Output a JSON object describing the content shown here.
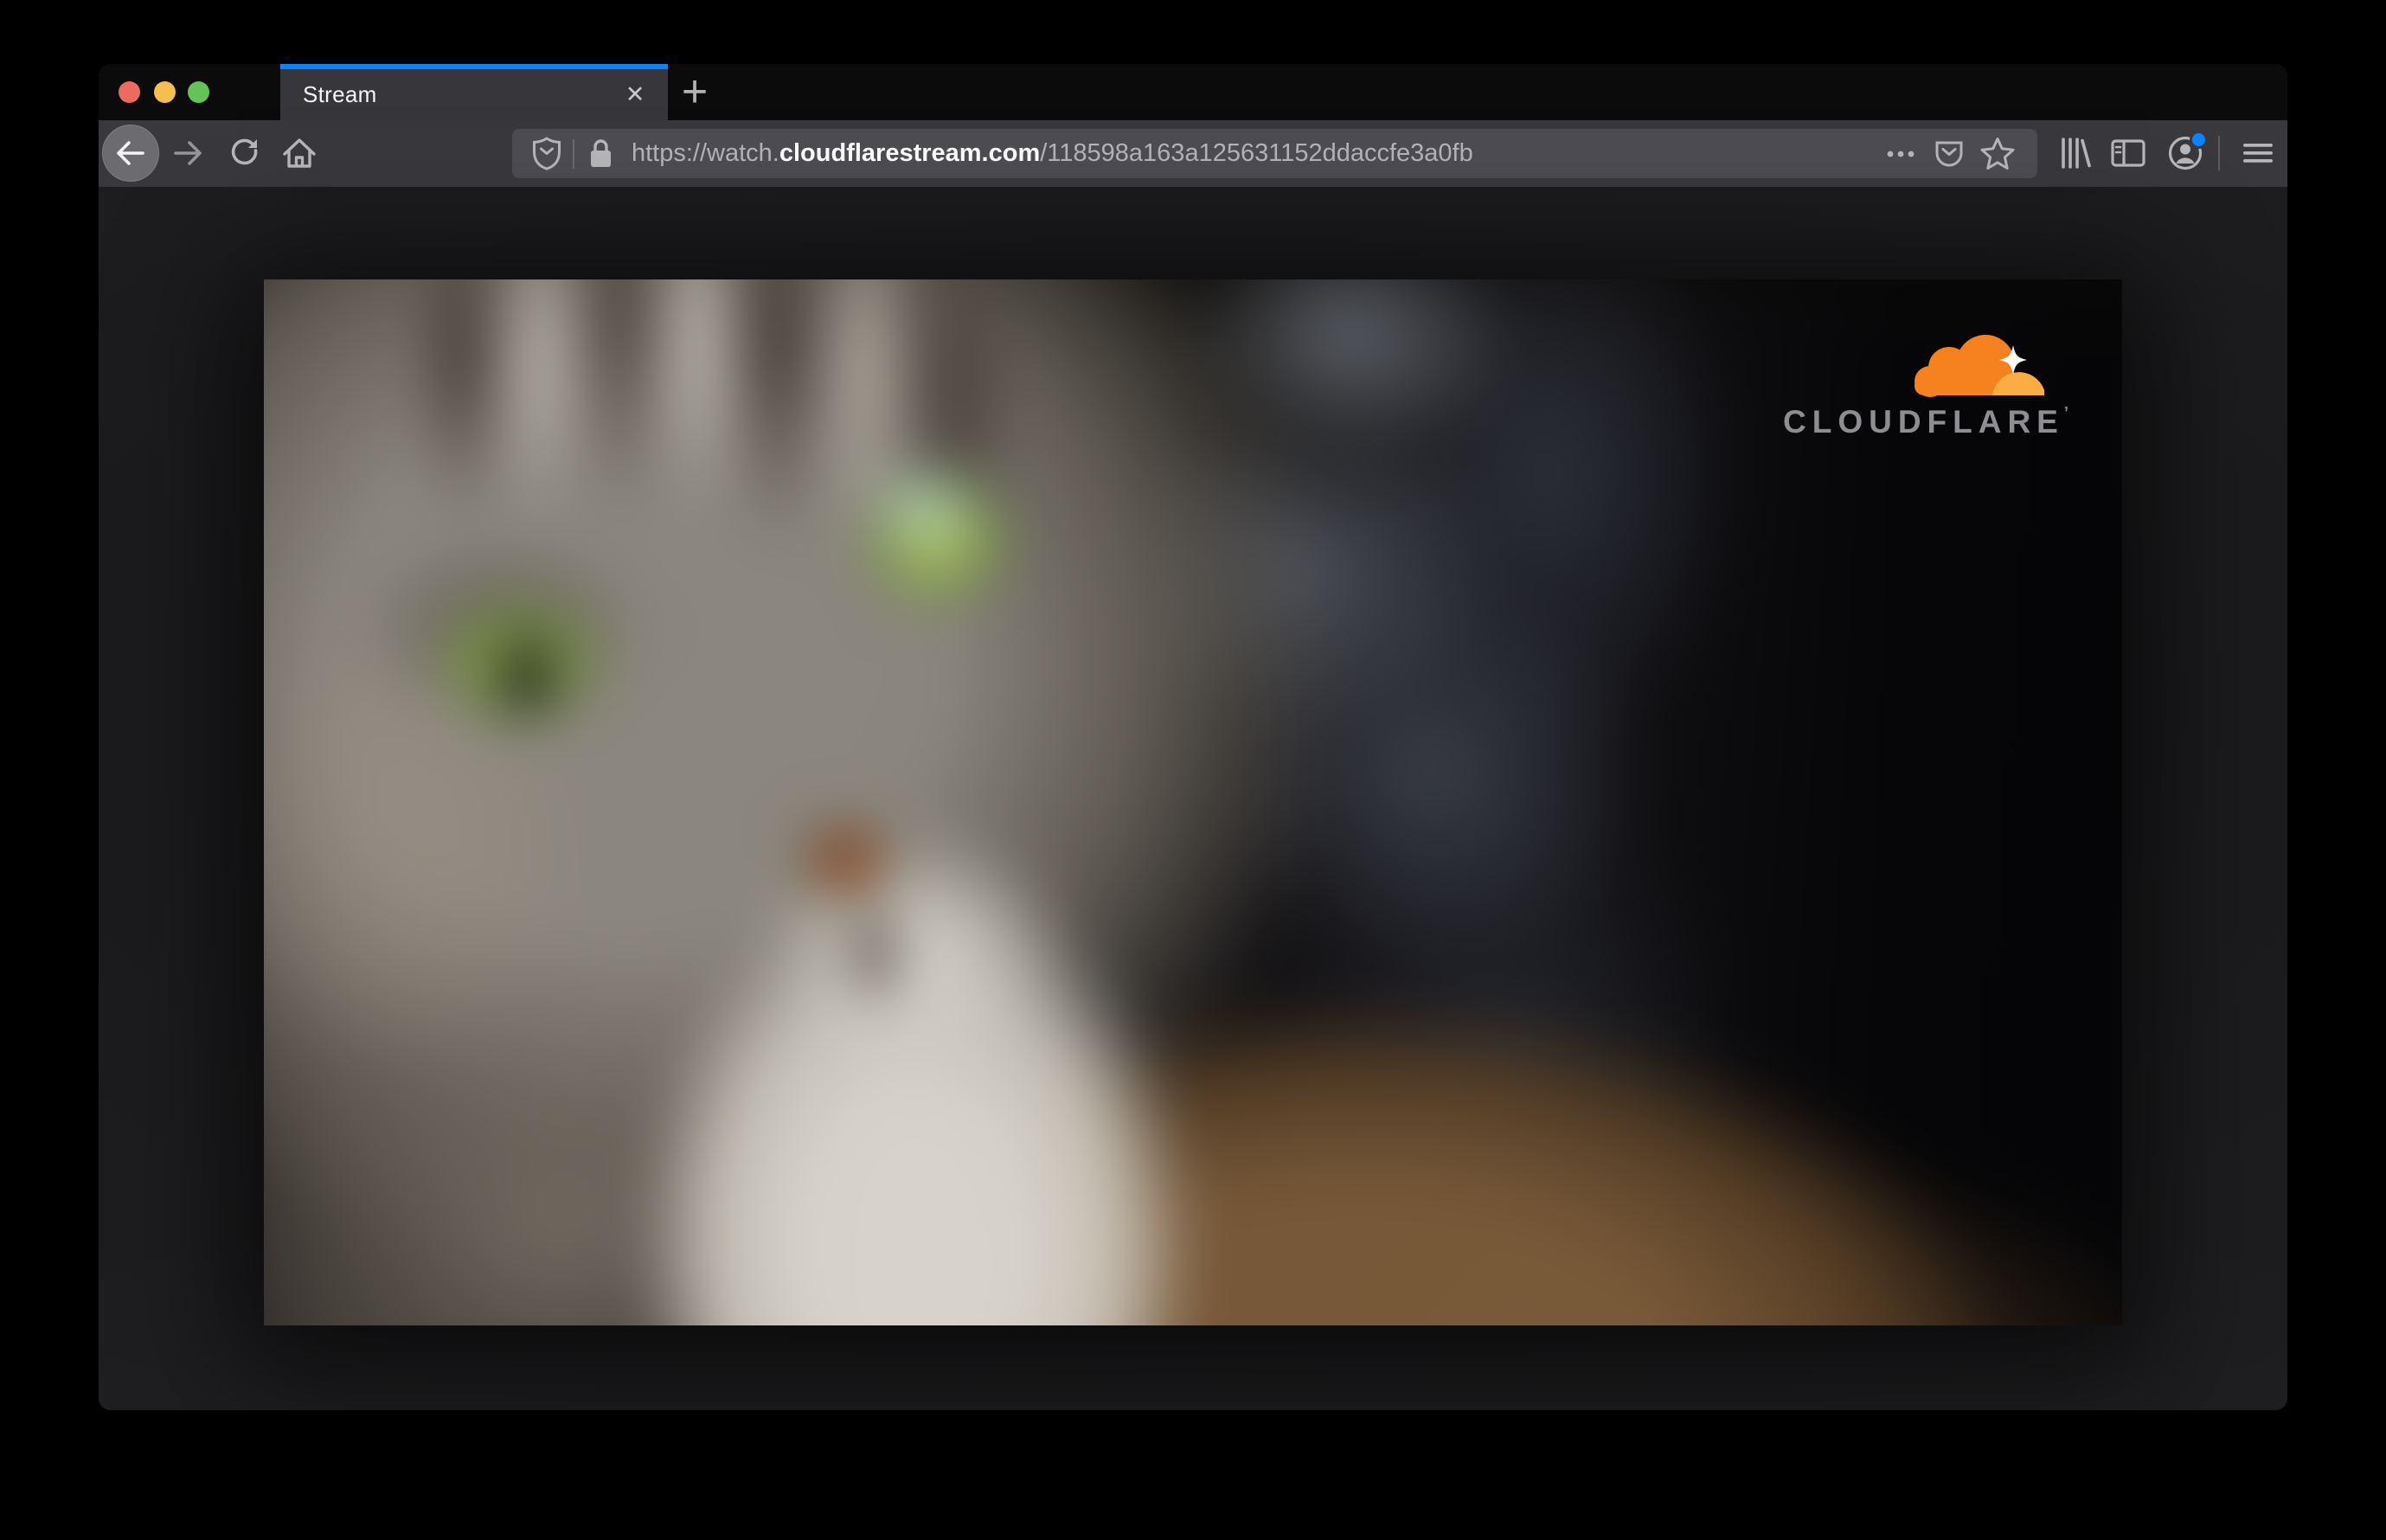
{
  "browser": {
    "window_controls": {
      "close_color": "#ec6a5e",
      "minimize_color": "#f5bf4f",
      "zoom_color": "#61c454"
    },
    "tab_strip": {
      "active_tab": {
        "title": "Stream",
        "close_label": "✕",
        "accent_color": "#0a84ff"
      },
      "new_tab_label": "+"
    },
    "navbar": {
      "buttons": [
        "back",
        "forward",
        "reload",
        "home"
      ],
      "url_bar": {
        "security_icons": [
          "tracking-protection-shield",
          "lock"
        ],
        "url_prefix": "https://watch.",
        "url_host": "cloudflarestream.com",
        "url_path": "/118598a163a125631152ddaccfe3a0fb",
        "action_icons": [
          "page-actions-ellipsis",
          "pocket",
          "bookmark-star"
        ]
      },
      "toolbar_icons": [
        "library",
        "sidebar",
        "account",
        "menu"
      ],
      "account_notification_color": "#0a84ff"
    }
  },
  "content": {
    "video_player": {
      "subject": "blurred close-up of a gray tabby cat with green eyes",
      "brand": {
        "wordmark": "CLOUDFLARE",
        "trademark_tick": "’",
        "cloud_orange": "#f6821f",
        "cloud_light_orange": "#fbad41",
        "wordmark_color": "#8e8e92"
      }
    }
  }
}
